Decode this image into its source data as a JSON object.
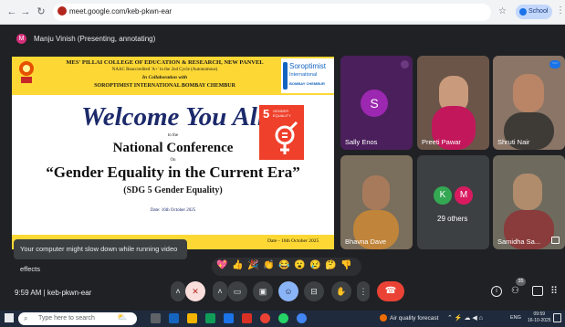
{
  "browser": {
    "url": "meet.google.com/keb-pkwn-ear",
    "profile_label": "School"
  },
  "presenter": {
    "initial": "M",
    "status": "Manju Vinish (Presenting, annotating)"
  },
  "slide": {
    "college": "MES' PILLAI COLLEGE OF EDUCATION & RESEARCH, NEW PANVEL",
    "naac": "NAAC Reaccredited 'A+' in the 2nd Cycle (Autonomous)",
    "collab": "In Collaboration with",
    "soroptimist": "SOROPTIMIST INTERNATIONAL BOMBAY CHEMBUR",
    "logo_title": "Soroptimist",
    "logo_sub": "International",
    "logo_city": "BOMBAY CHEMBUR",
    "welcome": "Welcome You All",
    "to_the": "to the",
    "conference": "National Conference",
    "on": "On",
    "theme": "“Gender Equality in the Current Era”",
    "sdg_subtitle": "(SDG 5 Gender Equality)",
    "date_small": "Date: 16th October 2025",
    "date_footer": "Date - 16th October 2025",
    "sdg_number": "5",
    "sdg_label_1": "GENDER",
    "sdg_label_2": "EQUALITY"
  },
  "toast": "Your computer might slow down while running video effects",
  "participants": [
    {
      "name": "Sally Enos",
      "initial": "S",
      "avatar_color": "#9c27b0"
    },
    {
      "name": "Preeti Pawar"
    },
    {
      "name": "Shruti Nair"
    },
    {
      "name": "Bhavna Dave"
    },
    {
      "name": "29 others",
      "initials": [
        "K",
        "M"
      ]
    },
    {
      "name": "Samidha Sa..."
    }
  ],
  "reactions": [
    "💖",
    "👍",
    "🎉",
    "👏",
    "😂",
    "😮",
    "😢",
    "🤔",
    "👎"
  ],
  "meeting": {
    "time_code": "9:59 AM  |  keb-pkwn-ear",
    "participant_count": "35"
  },
  "taskbar": {
    "search_placeholder": "Type here to search",
    "weather": "Air quality forecast",
    "lang": "ENG",
    "time": "09:59",
    "date": "16-10-2025"
  },
  "colors": {
    "meet_bg": "#202124",
    "end_call": "#ea4335",
    "slide_yellow": "#fdd835",
    "sdg_red": "#ef402b"
  }
}
